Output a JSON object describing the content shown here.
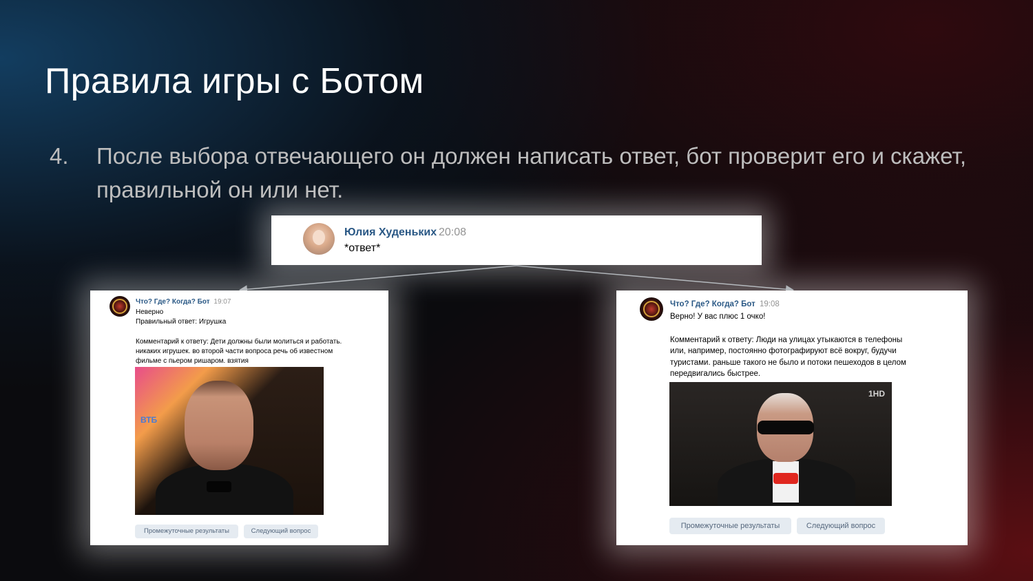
{
  "slide": {
    "title": "Правила игры с Ботом",
    "item_number": "4.",
    "item_text": "После выбора отвечающего он должен написать ответ, бот проверит его и скажет, правильной он или нет."
  },
  "user_message": {
    "author": "Юлия Худеньких",
    "time": "20:08",
    "text": "*ответ*"
  },
  "wrong_reply": {
    "author": "Что? Где? Когда? Бот",
    "time": "19:07",
    "line1": "Неверно",
    "line2": "Правильный ответ: Игрушка",
    "comment": "Комментарий к ответу: Дети должны были молиться и работать. никаких игрушек. во второй части вопроса речь об известном фильме с пьером ришаром. взятия",
    "photo_logo": "ВТБ",
    "button_results": "Промежуточные результаты",
    "button_next": "Следующий вопрос"
  },
  "correct_reply": {
    "author": "Что? Где? Когда? Бот",
    "time": "19:08",
    "line1": "Верно! У вас плюс 1 очко!",
    "comment": "Комментарий к ответу: Люди на улицах утыкаются в телефоны или, например, постоянно фотографируют всё вокруг, будучи туристами. раньше такого не было и потоки пешеходов в целом передвигались быстрее.",
    "photo_logo": "1HD",
    "button_results": "Промежуточные результаты",
    "button_next": "Следующий вопрос"
  }
}
